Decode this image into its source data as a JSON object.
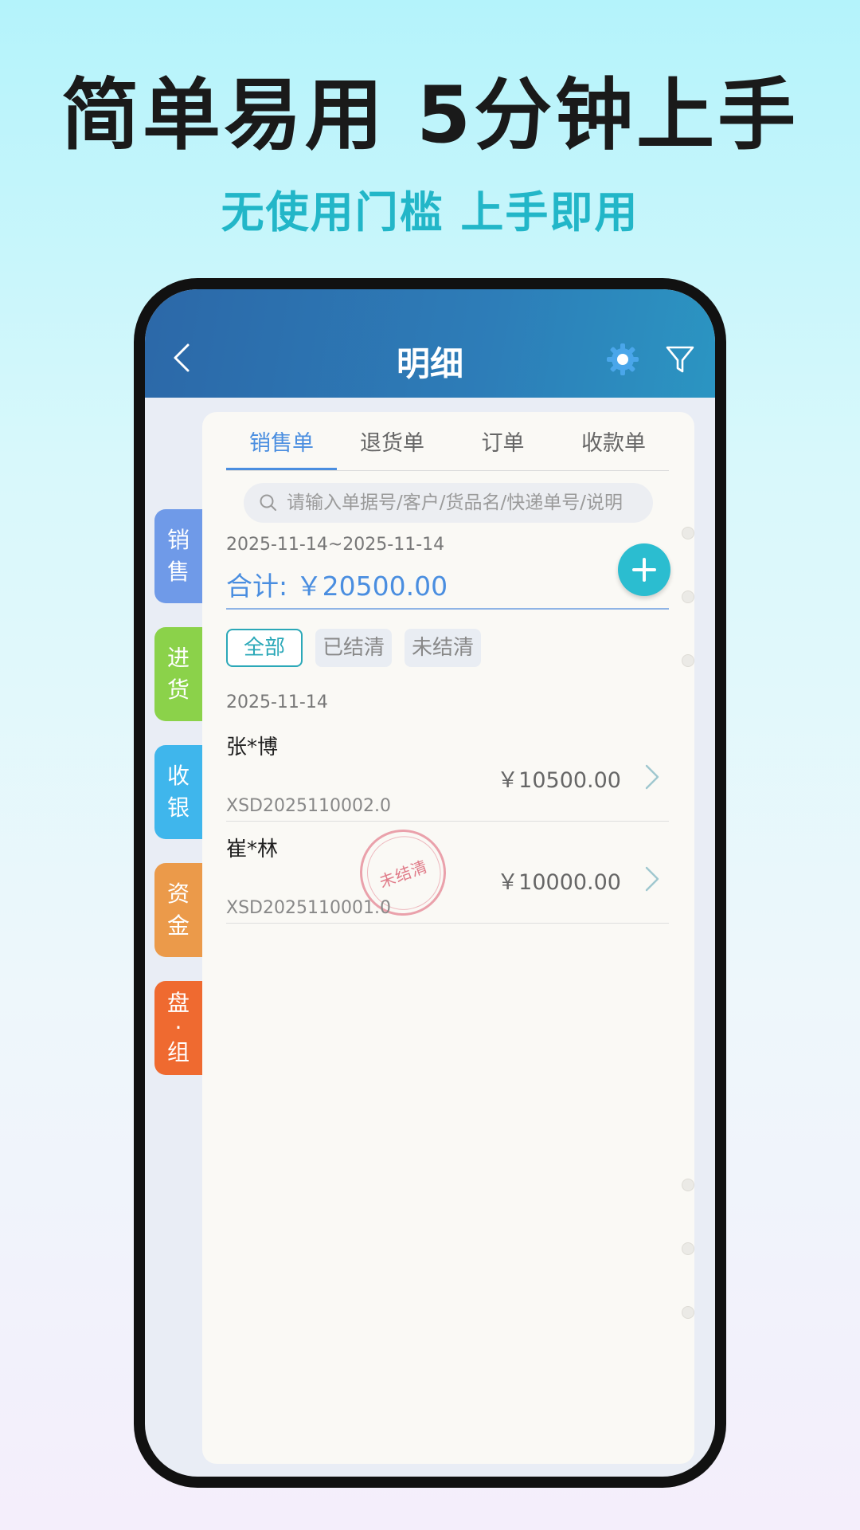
{
  "promo": {
    "headline": "简单易用 5分钟上手",
    "subline": "无使用门槛 上手即用"
  },
  "appbar": {
    "title": "明细",
    "icons": [
      "back-icon",
      "gear-icon",
      "filter-icon"
    ]
  },
  "side_tabs": [
    {
      "line1": "销",
      "line2": "售",
      "color": "#6f9ae8"
    },
    {
      "line1": "进",
      "line2": "货",
      "color": "#8bd24a"
    },
    {
      "line1": "收",
      "line2": "银",
      "color": "#3fb6ec"
    },
    {
      "line1": "资",
      "line2": "金",
      "color": "#eb9a4a"
    },
    {
      "line1": "盘",
      "line2": "·",
      "line3": "组",
      "color": "#ef6a30"
    }
  ],
  "tabs": [
    {
      "label": "销售单",
      "active": true
    },
    {
      "label": "退货单",
      "active": false
    },
    {
      "label": "订单",
      "active": false
    },
    {
      "label": "收款单",
      "active": false
    }
  ],
  "search": {
    "placeholder": "请输入单据号/客户/货品名/快递单号/说明"
  },
  "summary": {
    "date_range": "2025-11-14~2025-11-14",
    "total": "合计: ￥20500.00"
  },
  "filters": [
    {
      "label": "全部",
      "active": true
    },
    {
      "label": "已结清",
      "active": false
    },
    {
      "label": "未结清",
      "active": false
    }
  ],
  "records": {
    "group_date": "2025-11-14",
    "items": [
      {
        "name": "张*博",
        "amount": "￥10500.00",
        "number": "XSD2025110002.0",
        "stamp": ""
      },
      {
        "name": "崔*林",
        "amount": "￥10000.00",
        "number": "XSD2025110001.0",
        "stamp": "未结清"
      }
    ]
  },
  "colors": {
    "accent_blue": "#4a8ee0",
    "teal": "#2bbdd0",
    "appbar_start": "#2c68a8",
    "appbar_end": "#2b95c2",
    "stamp_red": "#d75064"
  }
}
